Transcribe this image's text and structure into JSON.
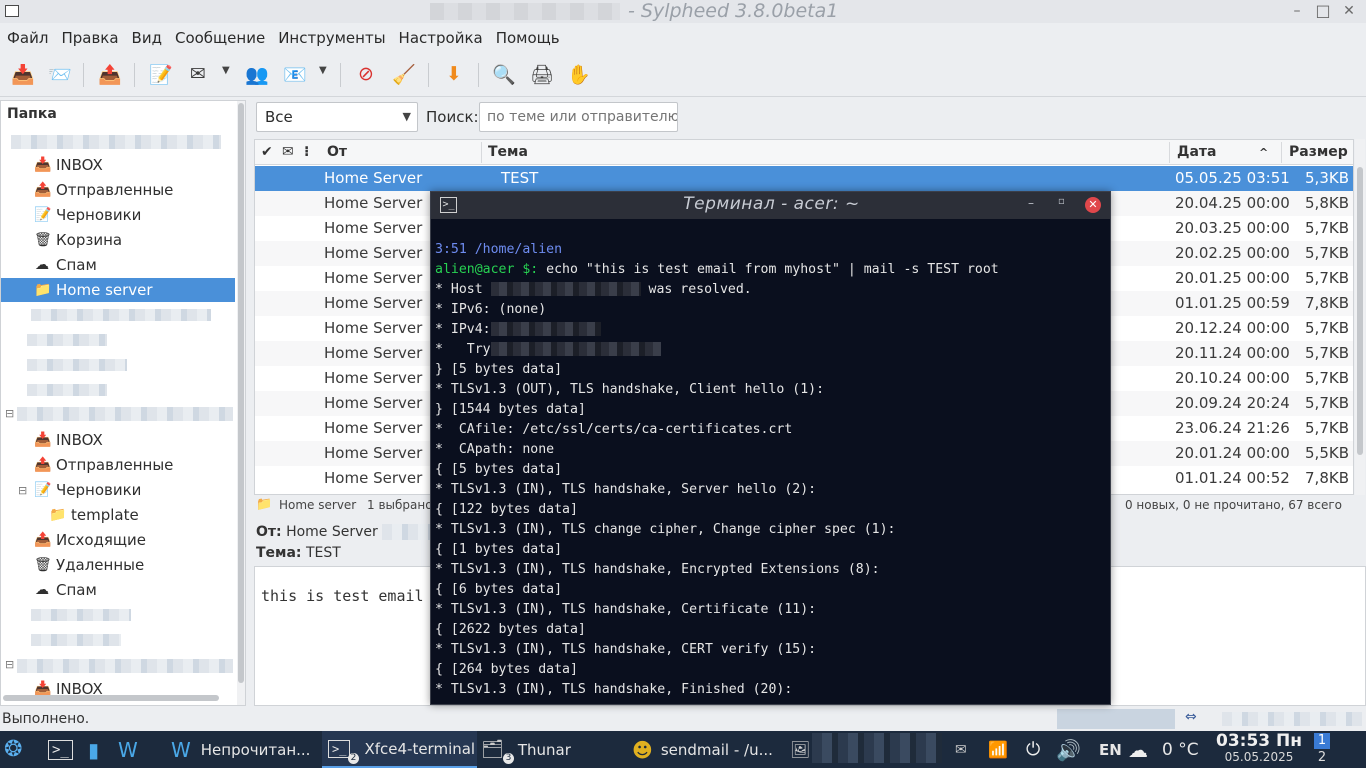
{
  "window": {
    "title": "- Sylpheed 3.8.0beta1",
    "minimize": "–",
    "maximize": "□",
    "close": "✕"
  },
  "menu": [
    "Файл",
    "Правка",
    "Вид",
    "Сообщение",
    "Инструменты",
    "Настройка",
    "Помощь"
  ],
  "toolbar": {
    "icons": [
      "get-mail-icon",
      "get-all-icon",
      "send-queue-icon",
      "compose-icon",
      "reply-icon",
      "reply-all-icon",
      "forward-icon",
      "delete-icon",
      "junk-icon",
      "next-icon",
      "search-icon",
      "print-icon",
      "stop-icon"
    ]
  },
  "folders": {
    "header": "Папка",
    "account1": [
      {
        "label": "INBOX",
        "icon": "inbox-icon"
      },
      {
        "label": "Отправленные",
        "icon": "sent-icon"
      },
      {
        "label": "Черновики",
        "icon": "drafts-icon"
      },
      {
        "label": "Корзина",
        "icon": "trash-icon"
      },
      {
        "label": "Спам",
        "icon": "spam-icon"
      },
      {
        "label": "Home server",
        "icon": "folder-icon",
        "selected": true
      }
    ],
    "account2": [
      {
        "label": "INBOX",
        "icon": "inbox-icon"
      },
      {
        "label": "Отправленные",
        "icon": "sent-icon"
      },
      {
        "label": "Черновики",
        "icon": "drafts-icon"
      },
      {
        "label": "template",
        "icon": "folder-icon"
      },
      {
        "label": "Исходящие",
        "icon": "outbox-icon"
      },
      {
        "label": "Удаленные",
        "icon": "trash-icon"
      },
      {
        "label": "Спам",
        "icon": "spam-icon"
      }
    ],
    "account3": [
      {
        "label": "INBOX",
        "icon": "inbox-icon"
      }
    ]
  },
  "filter": {
    "value": "Все",
    "search_label": "Поиск:",
    "search_placeholder": "по теме или отправителю"
  },
  "columns": {
    "check": "✔",
    "mark": "✉",
    "attach": "⁝",
    "from": "От",
    "subject": "Тема",
    "date": "Дата",
    "sort": "^",
    "size": "Размер"
  },
  "messages": [
    {
      "from": "Home Server",
      "subject": "TEST",
      "date": "05.05.25 03:51",
      "size": "5,3KB",
      "selected": true
    },
    {
      "from": "Home Server",
      "subject": "",
      "date": "20.04.25 00:00",
      "size": "5,8KB"
    },
    {
      "from": "Home Server",
      "subject": "",
      "date": "20.03.25 00:00",
      "size": "5,7KB"
    },
    {
      "from": "Home Server",
      "subject": "",
      "date": "20.02.25 00:00",
      "size": "5,7KB"
    },
    {
      "from": "Home Server",
      "subject": "",
      "date": "20.01.25 00:00",
      "size": "5,7KB"
    },
    {
      "from": "Home Server",
      "subject": "",
      "date": "01.01.25 00:59",
      "size": "7,8KB"
    },
    {
      "from": "Home Server",
      "subject": "",
      "date": "20.12.24 00:00",
      "size": "5,7KB"
    },
    {
      "from": "Home Server",
      "subject": "",
      "date": "20.11.24 00:00",
      "size": "5,7KB"
    },
    {
      "from": "Home Server",
      "subject": "",
      "date": "20.10.24 00:00",
      "size": "5,7KB"
    },
    {
      "from": "Home Server",
      "subject": "",
      "date": "20.09.24 20:24",
      "size": "5,7KB"
    },
    {
      "from": "Home Server",
      "subject": "",
      "date": "23.06.24 21:26",
      "size": "5,7KB"
    },
    {
      "from": "Home Server",
      "subject": "",
      "date": "20.01.24 00:00",
      "size": "5,5KB"
    },
    {
      "from": "Home Server",
      "subject": "",
      "date": "01.01.24 00:52",
      "size": "7,8KB"
    }
  ],
  "list_status": {
    "folder": "Home server",
    "selected": "1 выбрано",
    "counts": "0 новых, 0 не прочитано, 67 всего"
  },
  "message_view": {
    "from_label": "От:",
    "from": "Home Server",
    "subject_label": "Тема:",
    "subject": "TEST",
    "body": "this is test email"
  },
  "status": "Выполнено.",
  "terminal": {
    "title": "Терминал - acer: ~",
    "lines": [
      {
        "t": "3:51 /home/alien",
        "c": "blue"
      },
      {
        "prompt": "alien@acer $:",
        "t": " echo \"this is test email from myhost\" | mail -s TEST root"
      },
      {
        "t": "* Host ",
        "redact": 150,
        "t2": " was resolved."
      },
      {
        "t": "* IPv6: (none)"
      },
      {
        "t": "* IPv4:",
        "redact": 110
      },
      {
        "t": "*   Try",
        "redact": 170
      },
      {
        "t": "} [5 bytes data]"
      },
      {
        "t": "* TLSv1.3 (OUT), TLS handshake, Client hello (1):"
      },
      {
        "t": "} [1544 bytes data]"
      },
      {
        "t": "*  CAfile: /etc/ssl/certs/ca-certificates.crt"
      },
      {
        "t": "*  CApath: none"
      },
      {
        "t": "{ [5 bytes data]"
      },
      {
        "t": "* TLSv1.3 (IN), TLS handshake, Server hello (2):"
      },
      {
        "t": "{ [122 bytes data]"
      },
      {
        "t": "* TLSv1.3 (IN), TLS change cipher, Change cipher spec (1):"
      },
      {
        "t": "{ [1 bytes data]"
      },
      {
        "t": "* TLSv1.3 (IN), TLS handshake, Encrypted Extensions (8):"
      },
      {
        "t": "{ [6 bytes data]"
      },
      {
        "t": "* TLSv1.3 (IN), TLS handshake, Certificate (11):"
      },
      {
        "t": "{ [2622 bytes data]"
      },
      {
        "t": "* TLSv1.3 (IN), TLS handshake, CERT verify (15):"
      },
      {
        "t": "{ [264 bytes data]"
      },
      {
        "t": "* TLSv1.3 (IN), TLS handshake, Finished (20):"
      }
    ]
  },
  "taskbar": {
    "tasks": [
      {
        "label": "Непрочитан...",
        "icon": "sylpheed-icon"
      },
      {
        "label": "Xfce4-terminal",
        "icon": "terminal-icon",
        "badge": "2",
        "active": true
      },
      {
        "label": "Thunar",
        "icon": "file-manager-icon",
        "badge": "3"
      },
      {
        "label": "sendmail - /u...",
        "icon": "sendmail-icon"
      }
    ],
    "lang": "EN",
    "weather": "0 °C",
    "time": "03:53 Пн",
    "date": "05.05.2025",
    "workspaces": [
      "1",
      "2"
    ]
  }
}
